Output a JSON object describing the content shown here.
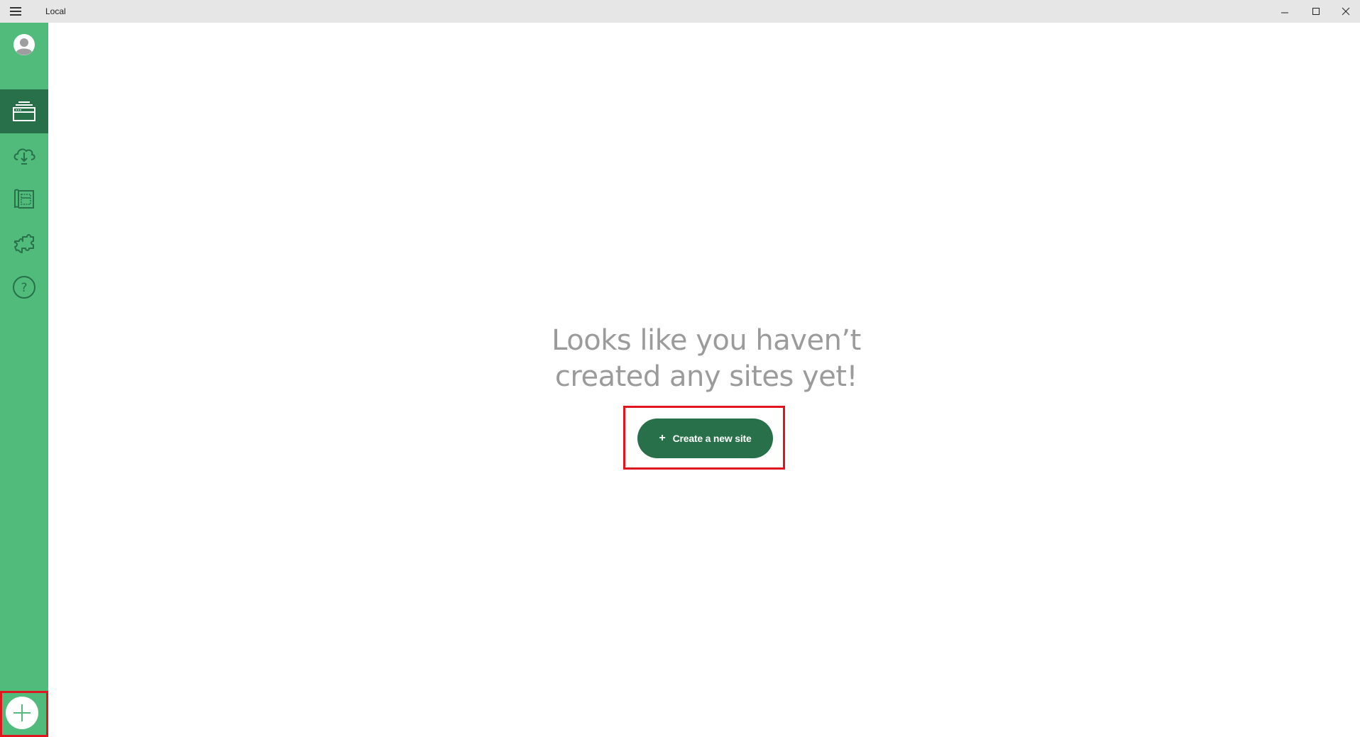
{
  "titlebar": {
    "app_title": "Local"
  },
  "sidebar": {
    "items": [
      {
        "name": "profile",
        "icon": "avatar-icon"
      },
      {
        "name": "local-sites",
        "icon": "sites-icon",
        "active": true
      },
      {
        "name": "connect",
        "icon": "cloud-connect-icon"
      },
      {
        "name": "blueprints",
        "icon": "blueprint-icon"
      },
      {
        "name": "add-ons",
        "icon": "puzzle-icon"
      },
      {
        "name": "help",
        "icon": "help-icon"
      }
    ],
    "add_button_icon": "plus-icon"
  },
  "main": {
    "empty_line1": "Looks like you haven’t",
    "empty_line2": "created any sites yet!",
    "create_button_plus": "+",
    "create_button_label": "Create a new site"
  },
  "colors": {
    "sidebar": "#51bb7b",
    "active": "#27704a",
    "highlight": "#e0161f",
    "empty_text": "#9b9b9b"
  }
}
